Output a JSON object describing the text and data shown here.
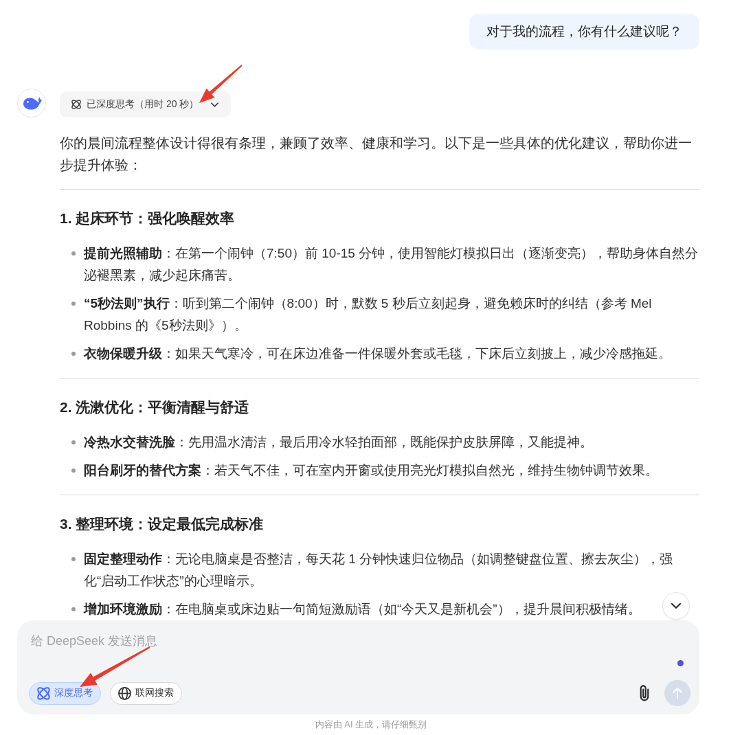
{
  "conversation": {
    "user_message": "对于我的流程，你有什么建议呢？",
    "thinking": {
      "label": "已深度思考（用时 20 秒）",
      "expanded": false
    },
    "reply": {
      "intro": "你的晨间流程整体设计得很有条理，兼顾了效率、健康和学习。以下是一些具体的优化建议，帮助你进一步提升体验：",
      "sections": [
        {
          "heading": "1. 起床环节：强化唤醒效率",
          "items": [
            "**提前光照辅助**：在第一个闹钟（7:50）前 10-15 分钟，使用智能灯模拟日出（逐渐变亮），帮助身体自然分泌褪黑素，减少起床痛苦。",
            "**“5秒法则”执行**：听到第二个闹钟（8:00）时，默数 5 秒后立刻起身，避免赖床时的纠结（参考 Mel Robbins 的《5秒法则》）。",
            "**衣物保暖升级**：如果天气寒冷，可在床边准备一件保暖外套或毛毯，下床后立刻披上，减少冷感拖延。"
          ]
        },
        {
          "heading": "2. 洗漱优化：平衡清醒与舒适",
          "items": [
            "**冷热水交替洗脸**：先用温水清洁，最后用冷水轻拍面部，既能保护皮肤屏障，又能提神。",
            "**阳台刷牙的替代方案**：若天气不佳，可在室内开窗或使用亮光灯模拟自然光，维持生物钟调节效果。"
          ]
        },
        {
          "heading": "3. 整理环境：设定最低完成标准",
          "items": [
            "**固定整理动作**：无论电脑桌是否整洁，每天花 1 分钟快速归位物品（如调整键盘位置、擦去灰尘），强化“启动工作状态”的心理暗示。",
            "**增加环境激励**：在电脑桌或床边贴一句简短激励语（如“今天又是新机会”），提升晨间积极情绪。"
          ]
        }
      ]
    }
  },
  "composer": {
    "placeholder": "给 DeepSeek 发送消息",
    "options": [
      {
        "kind": "deep_think",
        "label": "深度思考",
        "selected": true
      },
      {
        "kind": "web_search",
        "label": "联网搜索",
        "selected": false
      }
    ],
    "send_button": {
      "disabled": true
    }
  },
  "disclaimer": "内容由 AI 生成，请仔细甄别"
}
